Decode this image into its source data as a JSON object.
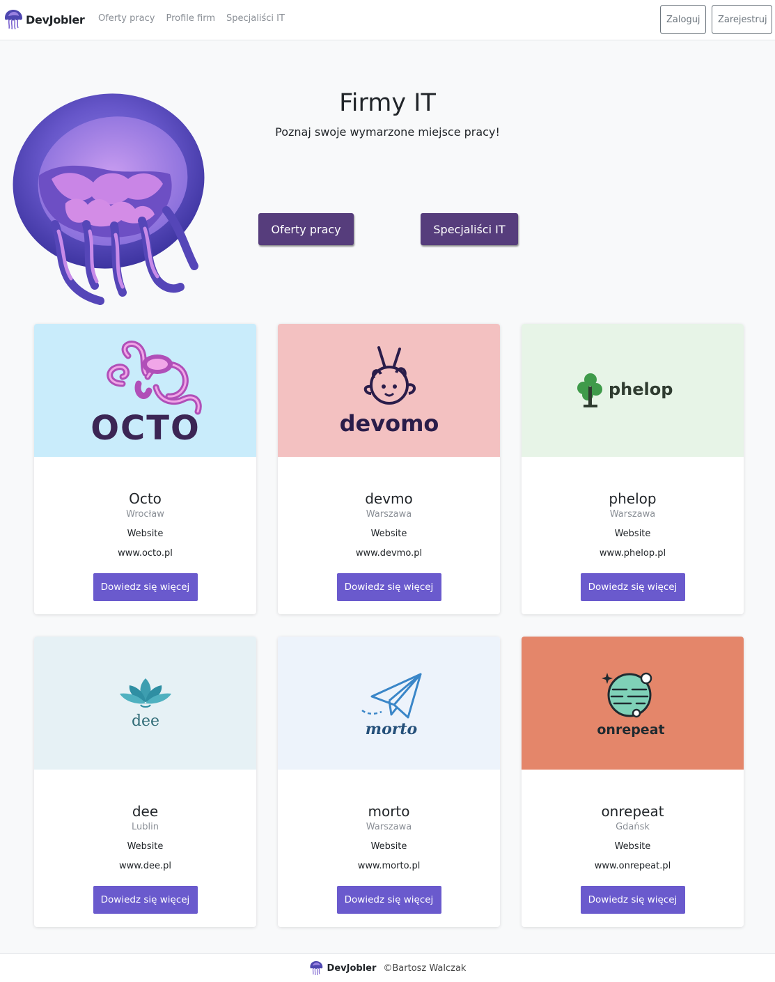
{
  "nav": {
    "brand": "DevJobler",
    "links": [
      "Oferty pracy",
      "Profile firm",
      "Specjaliści IT"
    ],
    "login": "Zaloguj",
    "register": "Zarejestruj"
  },
  "hero": {
    "title": "Firmy IT",
    "subtitle": "Poznaj swoje wymarzone miejsce pracy!",
    "btn_offers": "Oferty pracy",
    "btn_specialists": "Specjaliści IT"
  },
  "companies": [
    {
      "logo_text": "OCTO",
      "bg": "#c9ecfb",
      "name": "Octo",
      "city": "Wrocław",
      "website_label": "Website",
      "url": "www.octo.pl",
      "button": "Dowiedz się więcej"
    },
    {
      "logo_text": "devomo",
      "bg": "#f3c1c1",
      "name": "devmo",
      "city": "Warszawa",
      "website_label": "Website",
      "url": "www.devmo.pl",
      "button": "Dowiedz się więcej"
    },
    {
      "logo_text": "phelop",
      "bg": "#e7f4e7",
      "name": "phelop",
      "city": "Warszawa",
      "website_label": "Website",
      "url": "www.phelop.pl",
      "button": "Dowiedz się więcej"
    },
    {
      "logo_text": "dee",
      "bg": "#e6f1f5",
      "name": "dee",
      "city": "Lublin",
      "website_label": "Website",
      "url": "www.dee.pl",
      "button": "Dowiedz się więcej"
    },
    {
      "logo_text": "morto",
      "bg": "#edf3fb",
      "name": "morto",
      "city": "Warszawa",
      "website_label": "Website",
      "url": "www.morto.pl",
      "button": "Dowiedz się więcej"
    },
    {
      "logo_text": "onrepeat",
      "bg": "#e4866a",
      "name": "onrepeat",
      "city": "Gdańsk",
      "website_label": "Website",
      "url": "www.onrepeat.pl",
      "button": "Dowiedz się więcej"
    }
  ],
  "footer": {
    "brand": "DevJobler",
    "copyright": "©Bartosz Walczak"
  },
  "colors": {
    "primary": "#563d7c",
    "card_button": "#6a5acd",
    "jellyfish": "#5b4fb8"
  },
  "icons": [
    "jellyfish-logo-icon"
  ]
}
